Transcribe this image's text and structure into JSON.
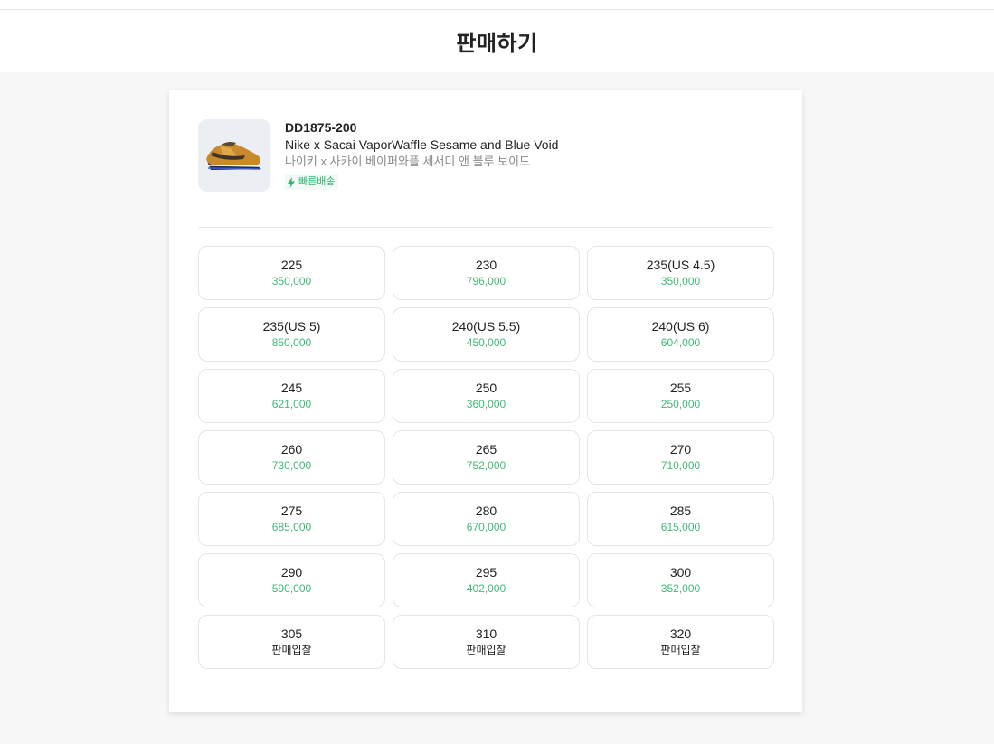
{
  "header": {
    "title": "판매하기"
  },
  "product": {
    "model_number": "DD1875-200",
    "name_en": "Nike x Sacai VaporWaffle Sesame and Blue Void",
    "name_ko": "나이키 x 사카이 베이퍼와플 세서미 앤 블루 보이드",
    "badge": {
      "icon": "lightning-icon",
      "label": "빠른배송",
      "color": "#31b46e"
    }
  },
  "colors": {
    "price": "#41b979",
    "bid": "#222222"
  },
  "sizes": [
    {
      "size": "225",
      "price": "350,000",
      "bid": false
    },
    {
      "size": "230",
      "price": "796,000",
      "bid": false
    },
    {
      "size": "235(US 4.5)",
      "price": "350,000",
      "bid": false
    },
    {
      "size": "235(US 5)",
      "price": "850,000",
      "bid": false
    },
    {
      "size": "240(US 5.5)",
      "price": "450,000",
      "bid": false
    },
    {
      "size": "240(US 6)",
      "price": "604,000",
      "bid": false
    },
    {
      "size": "245",
      "price": "621,000",
      "bid": false
    },
    {
      "size": "250",
      "price": "360,000",
      "bid": false
    },
    {
      "size": "255",
      "price": "250,000",
      "bid": false
    },
    {
      "size": "260",
      "price": "730,000",
      "bid": false
    },
    {
      "size": "265",
      "price": "752,000",
      "bid": false
    },
    {
      "size": "270",
      "price": "710,000",
      "bid": false
    },
    {
      "size": "275",
      "price": "685,000",
      "bid": false
    },
    {
      "size": "280",
      "price": "670,000",
      "bid": false
    },
    {
      "size": "285",
      "price": "615,000",
      "bid": false
    },
    {
      "size": "290",
      "price": "590,000",
      "bid": false
    },
    {
      "size": "295",
      "price": "402,000",
      "bid": false
    },
    {
      "size": "300",
      "price": "352,000",
      "bid": false
    },
    {
      "size": "305",
      "price": "판매입찰",
      "bid": true
    },
    {
      "size": "310",
      "price": "판매입찰",
      "bid": true
    },
    {
      "size": "320",
      "price": "판매입찰",
      "bid": true
    }
  ]
}
